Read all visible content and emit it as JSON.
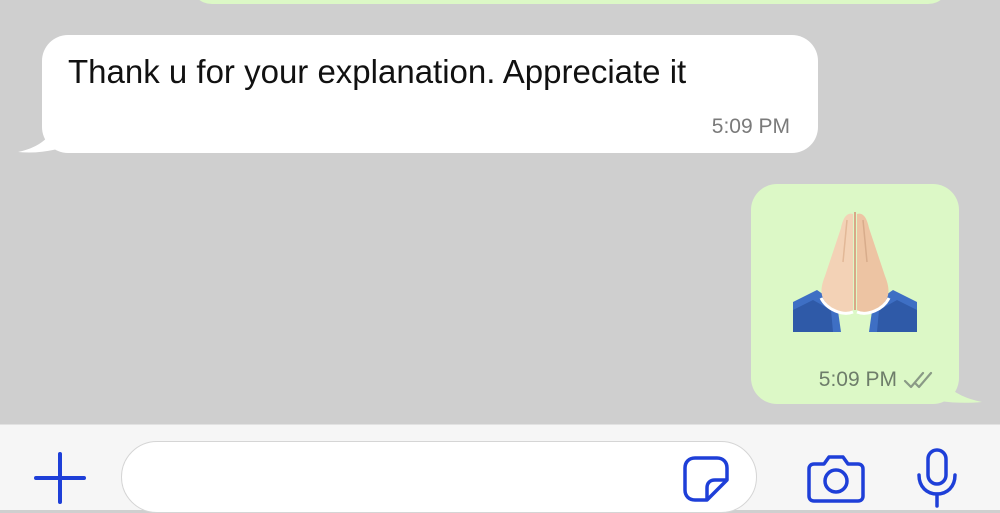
{
  "colors": {
    "chat_background": "#cfcfcf",
    "incoming_bubble": "#ffffff",
    "outgoing_bubble": "#dcf8c6",
    "accent": "#1e3fd8",
    "timestamp": "#7a7a7a"
  },
  "messages": [
    {
      "direction": "incoming",
      "text": "Thank u for your explanation. Appreciate it",
      "time": "5:09 PM"
    },
    {
      "direction": "outgoing",
      "content": "folded-hands-emoji",
      "time": "5:09 PM",
      "status": "read-double-check"
    }
  ],
  "composer": {
    "placeholder": "",
    "value": "",
    "icons": [
      "plus-icon",
      "sticker-icon",
      "camera-icon",
      "microphone-icon"
    ]
  }
}
